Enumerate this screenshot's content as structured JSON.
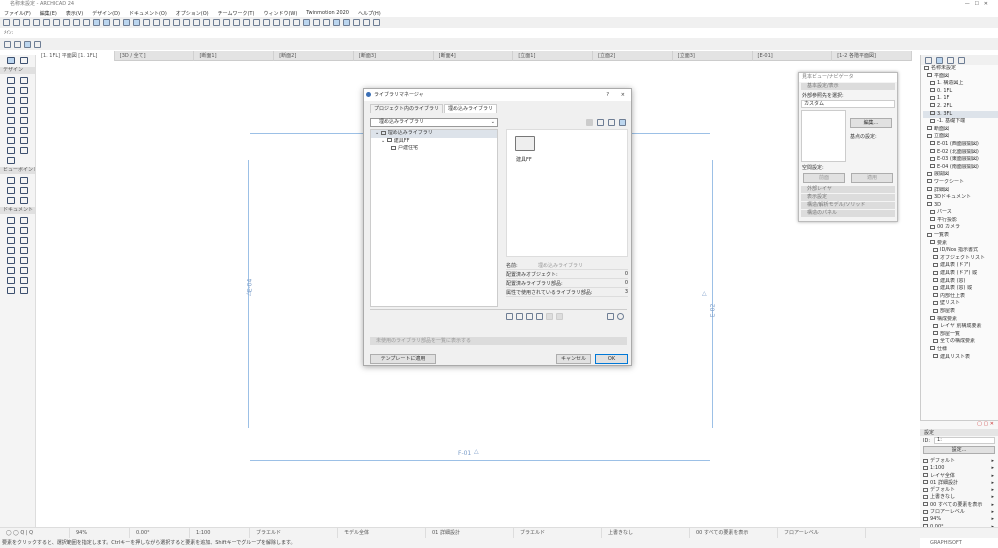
{
  "window": {
    "title": "名称未設定 - ARCHICAD 24"
  },
  "menu": [
    "ファイル(F)",
    "編集(E)",
    "表示(V)",
    "デザイン(D)",
    "ドキュメント(O)",
    "オプション(O)",
    "チームワーク(T)",
    "ウィンドウ(W)",
    "Twinmotion 2020",
    "ヘルプ(H)"
  ],
  "info_label": "ﾒｲﾝ:",
  "tabs": [
    "[1. 1FL] 平面図 [1. 1FL]",
    "[3D / 全て]",
    "[断面1]",
    "[断面2]",
    "[断面3]",
    "[断面4]",
    "[立面1]",
    "[立面2]",
    "[立面3]",
    "[E-01]",
    "[1-2 各階平面図]"
  ],
  "toolbox": {
    "sections": [
      "デザイン",
      "ビューポイント",
      "ドキュメント"
    ]
  },
  "drawing": {
    "labels": {
      "bottom": "F-01",
      "left": "E-04",
      "right": "E-02"
    }
  },
  "navigator_float": {
    "title": "見本ビュー/ナビゲータ",
    "section": "基本設定/表示",
    "select_label": "外部参照先を選択:",
    "select_value": "カスタム",
    "edit_button": "編集...",
    "reference_label": "基点の設定:",
    "summary_label": "空間設定:",
    "buttons": [
      "前面",
      "適用"
    ],
    "sections": [
      "外部レイヤ",
      "表示設定",
      "構造/解析モデル/ソリッド",
      "構造のパネル"
    ]
  },
  "navigator_tree": {
    "items": [
      {
        "label": "名称未設定",
        "level": 0
      },
      {
        "label": "平面図",
        "level": 1
      },
      {
        "label": "1. 構造図上",
        "level": 2
      },
      {
        "label": "0. 1FL",
        "level": 2
      },
      {
        "label": "1. 1F",
        "level": 2
      },
      {
        "label": "2. 2FL",
        "level": 2
      },
      {
        "label": "3. 3FL",
        "level": 2,
        "selected": true
      },
      {
        "label": "-1. 基礎下端",
        "level": 2
      },
      {
        "label": "断面図",
        "level": 1
      },
      {
        "label": "立面図",
        "level": 1
      },
      {
        "label": "E-01 (西面展開図)",
        "level": 2
      },
      {
        "label": "E-02 (北面展開図)",
        "level": 2
      },
      {
        "label": "E-03 (東面展開図)",
        "level": 2
      },
      {
        "label": "E-04 (南面展開図)",
        "level": 2
      },
      {
        "label": "展開図",
        "level": 1
      },
      {
        "label": "ワークシート",
        "level": 1
      },
      {
        "label": "詳細図",
        "level": 1
      },
      {
        "label": "3Dドキュメント",
        "level": 1
      },
      {
        "label": "3D",
        "level": 1
      },
      {
        "label": "パース",
        "level": 2
      },
      {
        "label": "平行投影",
        "level": 2
      },
      {
        "label": "00 カメラ",
        "level": 2
      },
      {
        "label": "一覧表",
        "level": 1
      },
      {
        "label": "要素",
        "level": 2
      },
      {
        "label": "ID/Nos 指示書式",
        "level": 3
      },
      {
        "label": "オブジェクトリスト",
        "level": 3
      },
      {
        "label": "建具表 (ドア)",
        "level": 3
      },
      {
        "label": "建具表 (ドア) 縦",
        "level": 3
      },
      {
        "label": "建具表 (窓)",
        "level": 3
      },
      {
        "label": "建具表 (窓) 縦",
        "level": 3
      },
      {
        "label": "内部仕上表",
        "level": 3
      },
      {
        "label": "壁リスト",
        "level": 3
      },
      {
        "label": "部屋表",
        "level": 3
      },
      {
        "label": "構成要素",
        "level": 2
      },
      {
        "label": "レイヤ 別構成要素",
        "level": 3
      },
      {
        "label": "部屋一覧",
        "level": 3
      },
      {
        "label": "全ての構成要素",
        "level": 3
      },
      {
        "label": "仕様",
        "level": 2
      },
      {
        "label": "建具リスト表",
        "level": 3
      }
    ]
  },
  "properties": {
    "header": "設定",
    "id_label": "ID:",
    "id_value": "1:",
    "settings_button": "設定...",
    "items": [
      "デフォルト",
      "1:100",
      "レイヤ全体",
      "01 詳細設計",
      "デフォルト",
      "上書きなし",
      "00 すべての要素を表示",
      "フロアーレベル",
      "94%",
      "0.00°"
    ]
  },
  "dialog": {
    "title": "ライブラリマネージャ",
    "help": "?",
    "close": "×",
    "tabs": [
      "プロジェクト内のライブラリ",
      "埋め込みライブラリ"
    ],
    "dropdown": "埋め込みライブラリ",
    "tree": [
      "埋め込みライブラリ",
      "建具FF",
      "戸建住宅"
    ],
    "folder_label": "建具FF",
    "name_label": "名前:",
    "name_value": "埋め込みライブラリ",
    "stats": [
      {
        "label": "配置済みオブジェクト:",
        "value": "0"
      },
      {
        "label": "配置済みライブラリ部品:",
        "value": "0"
      },
      {
        "label": "属性で使用されているライブラリ部品:",
        "value": "3"
      }
    ],
    "bar_text": "未使用のライブラリ部品を一覧に表示する",
    "bottom_left_button": "テンプレートに適用",
    "cancel": "キャンセル",
    "ok": "OK"
  },
  "status": [
    "94%",
    "0.00°",
    "1:100",
    "ブラエルド",
    "モデル全体",
    "01 詳細設計",
    "ブラエルド",
    "上書きなし",
    "00 すべての要素を表示",
    "フロアーレベル"
  ],
  "hint": "要素をクリックすると、選択範囲を指定します。Ctrlキーを押しながら選択すると要素を追加、Shiftキーでグループを解除します。",
  "brand": "GRAPHISOFT",
  "colors": {
    "accent": "#bcd6ef",
    "drawing_line": "#9cc0e6"
  }
}
